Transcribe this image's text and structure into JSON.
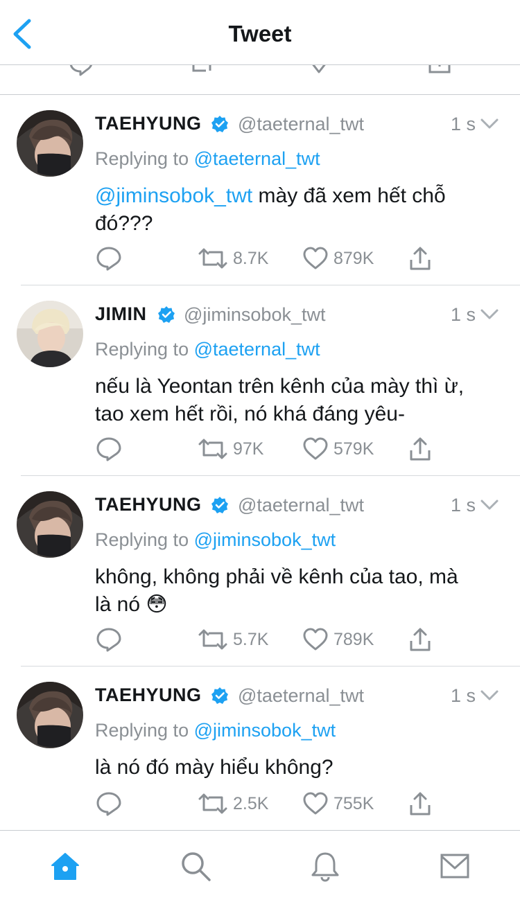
{
  "header": {
    "title": "Tweet",
    "back_icon": "chevron-left-icon"
  },
  "colors": {
    "accent": "#1da1f2",
    "text": "#14171a",
    "muted": "#8a8f94",
    "divider": "#d6dadd"
  },
  "reply_prefix": "Replying to",
  "tweets": [
    {
      "name": "TAEHYUNG",
      "handle": "@taeternal_twt",
      "time": "1 s",
      "replying_to": "@taeternal_twt",
      "mention": "@jiminsobok_twt",
      "text": " mày đã xem hết chỗ đó???",
      "text_line2": "",
      "retweets": "8.7K",
      "likes": "879K"
    },
    {
      "name": "JIMIN",
      "handle": "@jiminsobok_twt",
      "time": "1 s",
      "replying_to": "@taeternal_twt",
      "mention": "",
      "text": "nếu là Yeontan trên kênh của mày thì ừ,",
      "text_line2": "tao xem hết rồi, nó khá đáng yêu-",
      "retweets": "97K",
      "likes": "579K"
    },
    {
      "name": "TAEHYUNG",
      "handle": "@taeternal_twt",
      "time": "1 s",
      "replying_to": "@jiminsobok_twt",
      "mention": "",
      "text": "không, không phải về kênh của tao, mà",
      "text_line2": "là nó 😳",
      "retweets": "5.7K",
      "likes": "789K"
    },
    {
      "name": "TAEHYUNG",
      "handle": "@taeternal_twt",
      "time": "1 s",
      "replying_to": "@jiminsobok_twt",
      "mention": "",
      "text": "là nó đó mày hiểu không?",
      "text_line2": "",
      "retweets": "2.5K",
      "likes": "755K"
    }
  ],
  "tabbar": {
    "items": [
      "home-icon",
      "search-icon",
      "notifications-bell-icon",
      "messages-envelope-icon"
    ],
    "active": "home-icon"
  }
}
